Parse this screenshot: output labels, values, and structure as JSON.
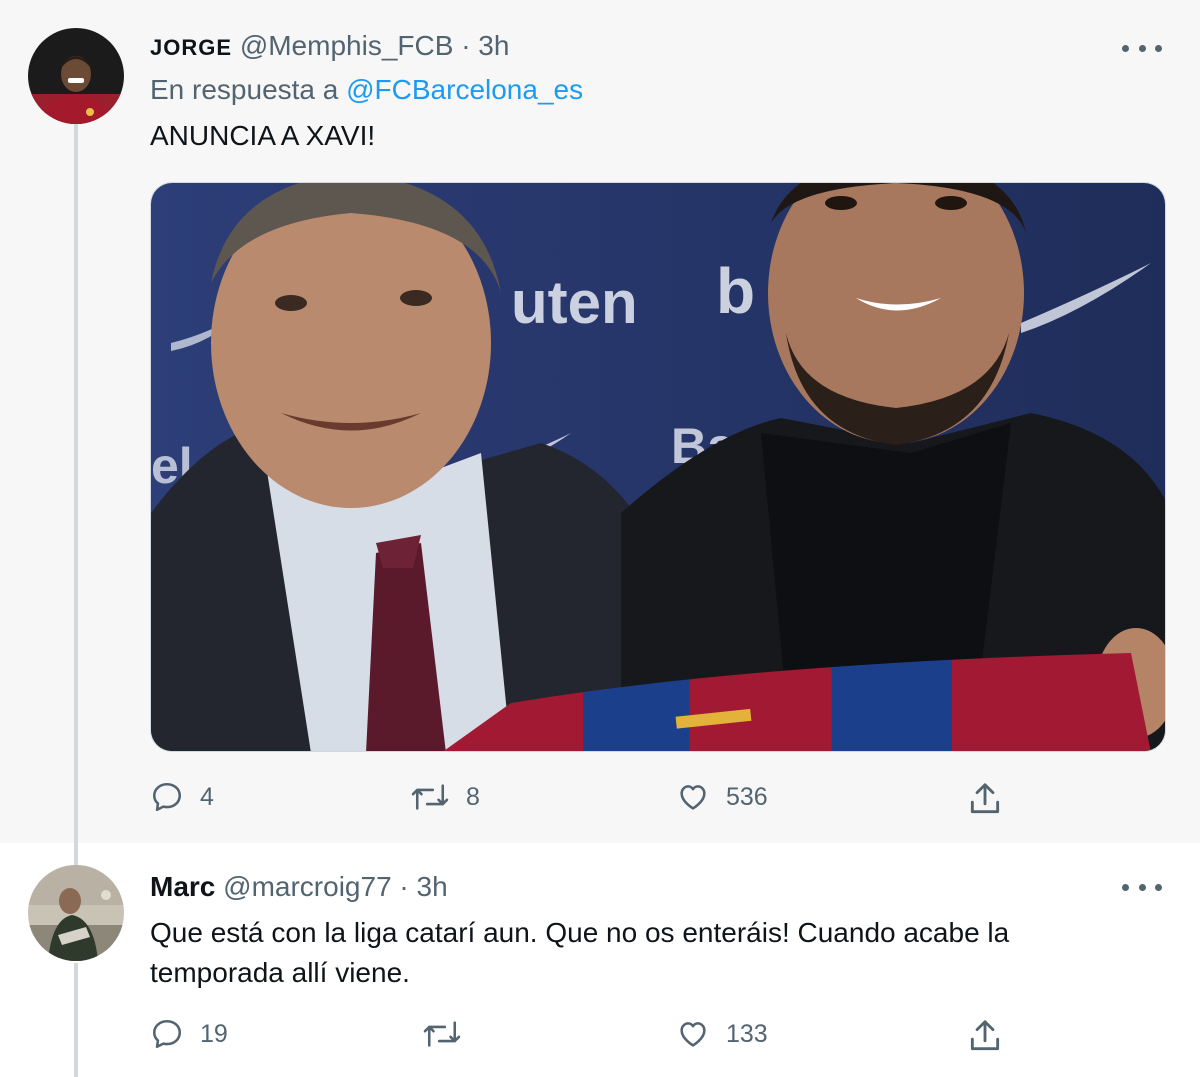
{
  "tweets": [
    {
      "name": "JORGE",
      "handle": "@Memphis_FCB",
      "time": "· 3h",
      "reply_prefix": "En respuesta a",
      "reply_handle": "@FCBarcelona_es",
      "text": "ANUNCIA A XAVI!",
      "media_wall_text": [
        "uten",
        "b",
        "Ba",
        "el"
      ],
      "counts": {
        "reply": "4",
        "retweet": "8",
        "like": "536"
      },
      "icons": [
        "reply-icon",
        "retweet-icon",
        "like-icon",
        "share-icon",
        "more-icon"
      ]
    },
    {
      "name": "Marc",
      "handle": "@marcroig77",
      "time": "· 3h",
      "text": "Que está con la liga catarí aun. Que no os enteráis! Cuando acabe la temporada allí viene.",
      "counts": {
        "reply": "19",
        "retweet": "",
        "like": "133"
      }
    }
  ],
  "colors": {
    "link": "#1d9bf0",
    "muted": "#536471",
    "thread_line": "#cfd9de",
    "highlight_bg": "#f7f7f7"
  }
}
